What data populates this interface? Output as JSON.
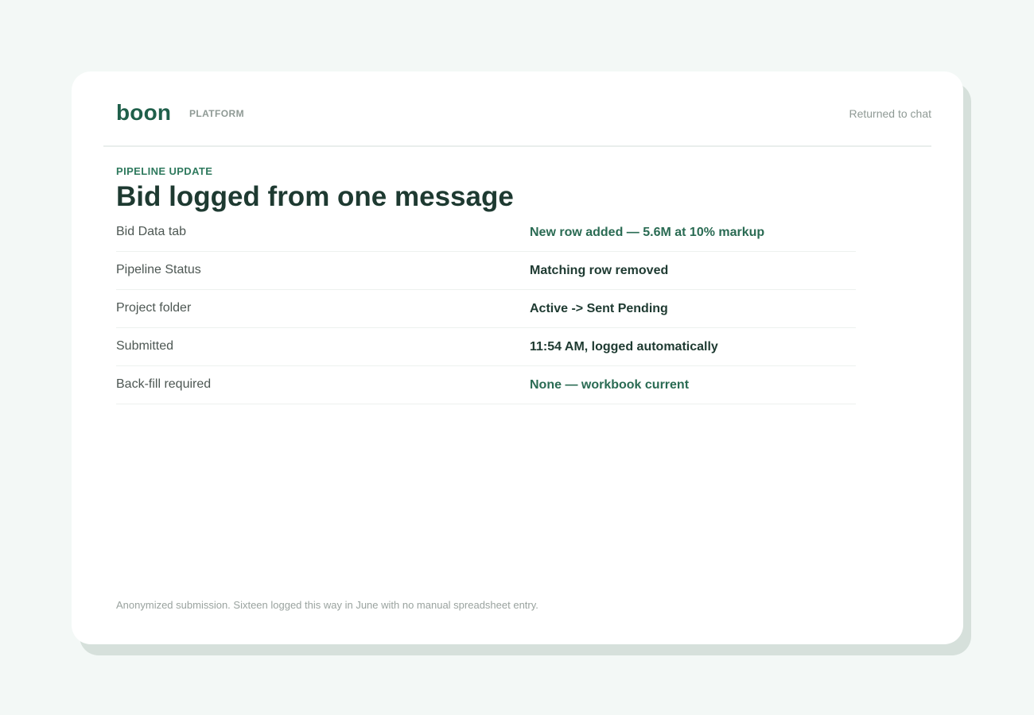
{
  "brand": {
    "logo": "boon",
    "platform_label": "PLATFORM"
  },
  "header": {
    "status_link": "Returned to chat"
  },
  "content": {
    "eyebrow": "PIPELINE UPDATE",
    "title": "Bid logged from one message"
  },
  "rows": [
    {
      "label": "Bid Data tab",
      "value": "New row added — 5.6M at 10% markup",
      "accent": true
    },
    {
      "label": "Pipeline Status",
      "value": "Matching row removed",
      "accent": false
    },
    {
      "label": "Project folder",
      "value": "Active -> Sent Pending",
      "accent": false
    },
    {
      "label": "Submitted",
      "value": "11:54 AM, logged automatically",
      "accent": false
    },
    {
      "label": "Back-fill required",
      "value": "None — workbook current",
      "accent": true
    }
  ],
  "footer": {
    "note": "Anonymized submission. Sixteen logged this way in June with no manual spreadsheet entry."
  },
  "colors": {
    "brand_green": "#1f5f4a",
    "accent_green": "#2a6b53",
    "background": "#f3f8f6"
  }
}
